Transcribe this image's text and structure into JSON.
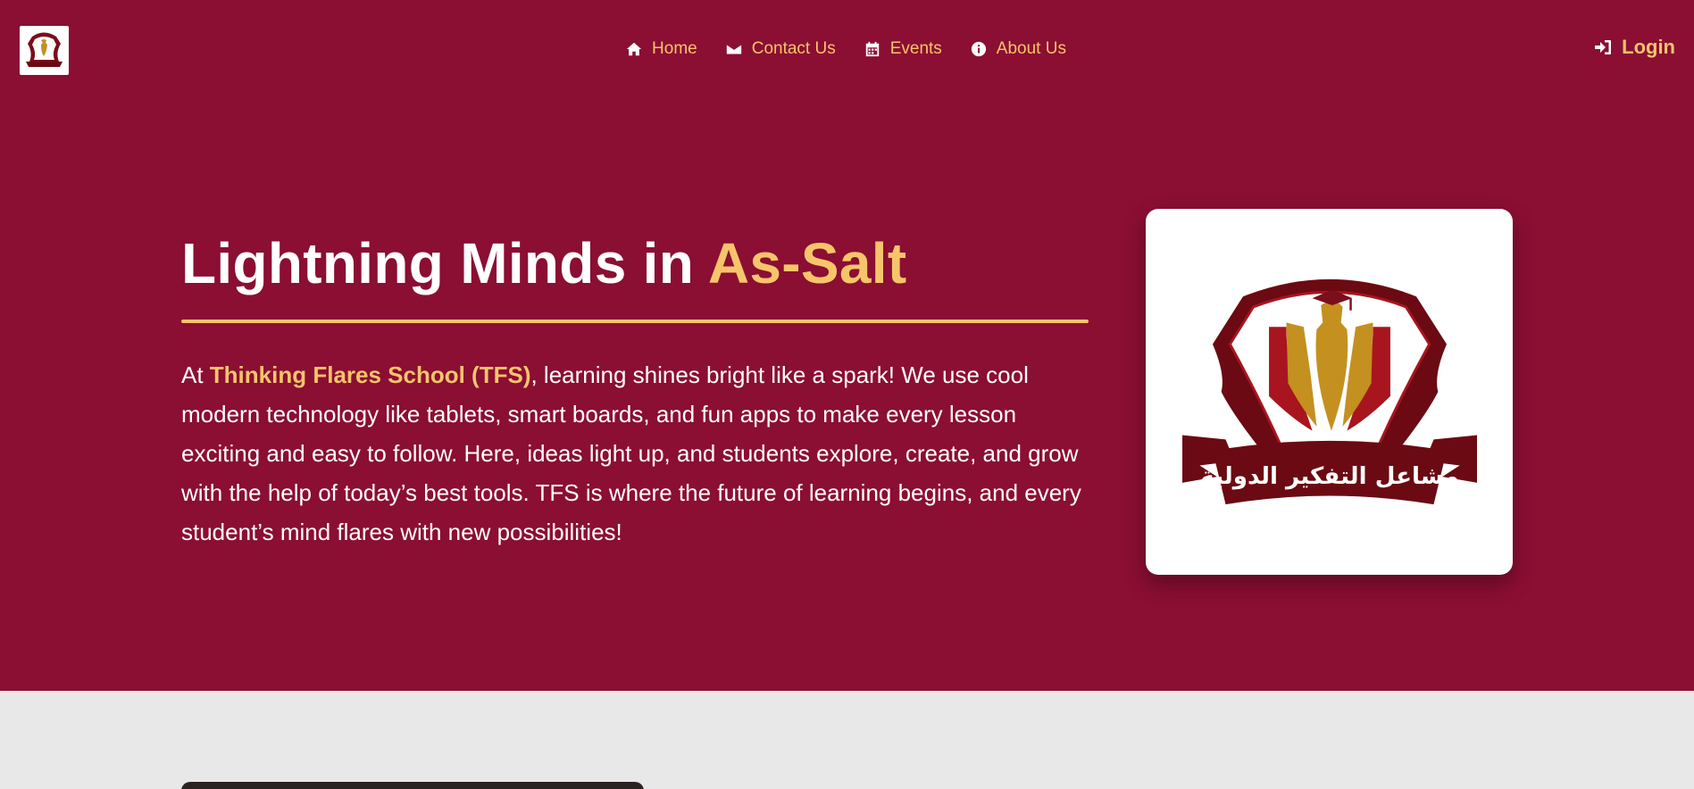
{
  "nav": {
    "items": [
      {
        "label": "Home",
        "icon": "home-icon"
      },
      {
        "label": "Contact Us",
        "icon": "envelope-icon"
      },
      {
        "label": "Events",
        "icon": "calendar-icon"
      },
      {
        "label": "About Us",
        "icon": "info-icon"
      }
    ],
    "login_label": "Login"
  },
  "hero": {
    "title_main": "Lightning Minds in ",
    "title_accent": "As-Salt",
    "intro_prefix": "At ",
    "school_name": "Thinking Flares School (TFS)",
    "intro_rest": ", learning shines bright like a spark! We use cool modern technology like tablets, smart boards, and fun apps to make every lesson exciting and easy to follow. Here, ideas light up, and students explore, create, and grow with the help of today’s best tools. TFS is where the future of learning begins, and every student’s mind flares with new possibilities!"
  },
  "logo": {
    "caption_ar": "مشاعل التفكير الدولية"
  },
  "colors": {
    "hero_bg": "#8b0e33",
    "accent": "#f6c56a",
    "crest_dark": "#6b0a12",
    "crest_gold": "#c4901f"
  }
}
